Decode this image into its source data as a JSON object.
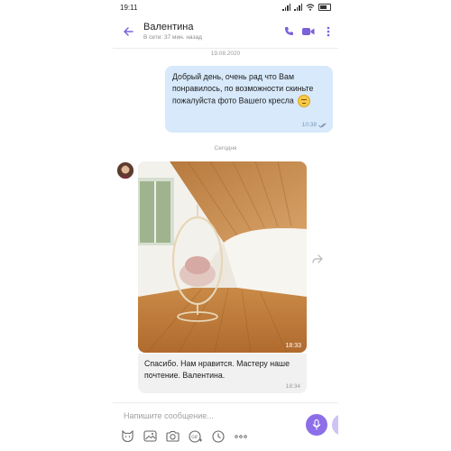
{
  "status_bar": {
    "time": "19:11"
  },
  "header": {
    "title": "Валентина",
    "subtitle": "В сети: 37 мин. назад"
  },
  "messages": {
    "date_separator_1": "19.08.2020",
    "outgoing_text": "Добрый день, очень рад что Вам понравилось, по возможности скиньте пожалуйста фото Вашего кресла",
    "outgoing_time": "10:38",
    "date_separator_2": "Сегодня",
    "photo_time": "18:33",
    "incoming_text": "Спасибо. Нам нравится. Мастеру наше почтение. Валентина.",
    "incoming_time": "18:34"
  },
  "composer": {
    "placeholder": "Напишите сообщение..."
  },
  "icons": {
    "back": "arrow-left-icon",
    "call": "phone-icon",
    "video": "video-camera-icon",
    "menu": "more-vertical-icon",
    "forward": "share-forward-icon",
    "sticker": "cat-sticker-icon",
    "gallery": "image-icon",
    "camera": "camera-icon",
    "gif": "gif-icon",
    "timer": "clock-icon",
    "more": "more-horizontal-icon",
    "mic": "microphone-icon",
    "ticks": "double-check-icon"
  },
  "colors": {
    "accent": "#7b61d9",
    "outgoing_bubble": "#d7e9fb",
    "incoming_bubble": "#f1f1f1"
  }
}
